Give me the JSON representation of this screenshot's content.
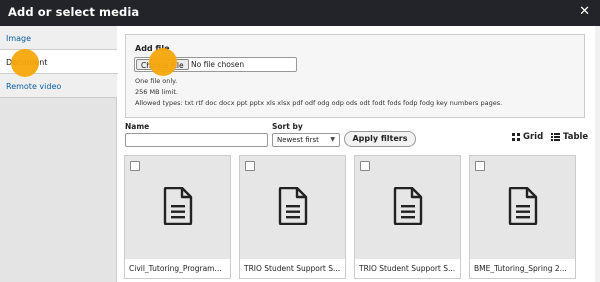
{
  "dialog": {
    "title": "Add or select media",
    "close_glyph": "✕"
  },
  "sidebar": {
    "tabs": [
      {
        "label": "Image"
      },
      {
        "label": "Document"
      },
      {
        "label": "Remote video"
      }
    ]
  },
  "upload": {
    "label": "Add file",
    "choose_button": "Choose File",
    "no_file_text": "No file chosen",
    "help": [
      "One file only.",
      "256 MB limit.",
      "Allowed types: txt rtf doc docx ppt pptx xls xlsx pdf odf odg odp ods odt fodt fods fodp fodg key numbers pages."
    ]
  },
  "filters": {
    "name_label": "Name",
    "name_value": "",
    "sort_label": "Sort by",
    "sort_value": "Newest first",
    "apply_label": "Apply filters"
  },
  "view": {
    "grid_label": "Grid",
    "table_label": "Table"
  },
  "items": [
    {
      "caption": "Civil_Tutoring_Program..."
    },
    {
      "caption": "TRIO Student Support S..."
    },
    {
      "caption": "TRIO Student Support S..."
    },
    {
      "caption": "BME_Tutoring_Spring 2..."
    }
  ],
  "colors": {
    "titlebar": "#232429",
    "accent_cursor": "#f7a70a",
    "link": "#0a5fa3"
  }
}
